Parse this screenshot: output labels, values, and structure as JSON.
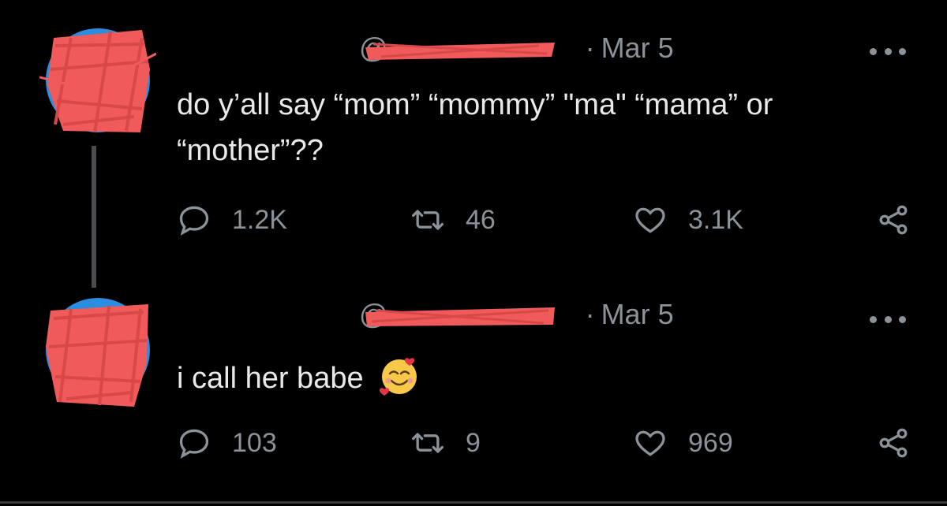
{
  "tweets": [
    {
      "handle_prefix": "@",
      "date": "Mar 5",
      "text": "do y’all say “mom” “mommy” \"ma\" “mama” or “mother”??",
      "replies": "1.2K",
      "retweets": "46",
      "likes": "3.1K"
    },
    {
      "handle_prefix": "@",
      "date": "Mar 5",
      "text": "i call her babe",
      "emoji": "smiling-face-with-hearts",
      "replies": "103",
      "retweets": "9",
      "likes": "969"
    }
  ],
  "colors": {
    "background": "#000000",
    "text": "#e7e9ea",
    "secondary": "#8b9298",
    "redaction": "#f05a5a"
  },
  "icons": [
    "reply-icon",
    "retweet-icon",
    "like-icon",
    "share-icon",
    "more-icon"
  ]
}
